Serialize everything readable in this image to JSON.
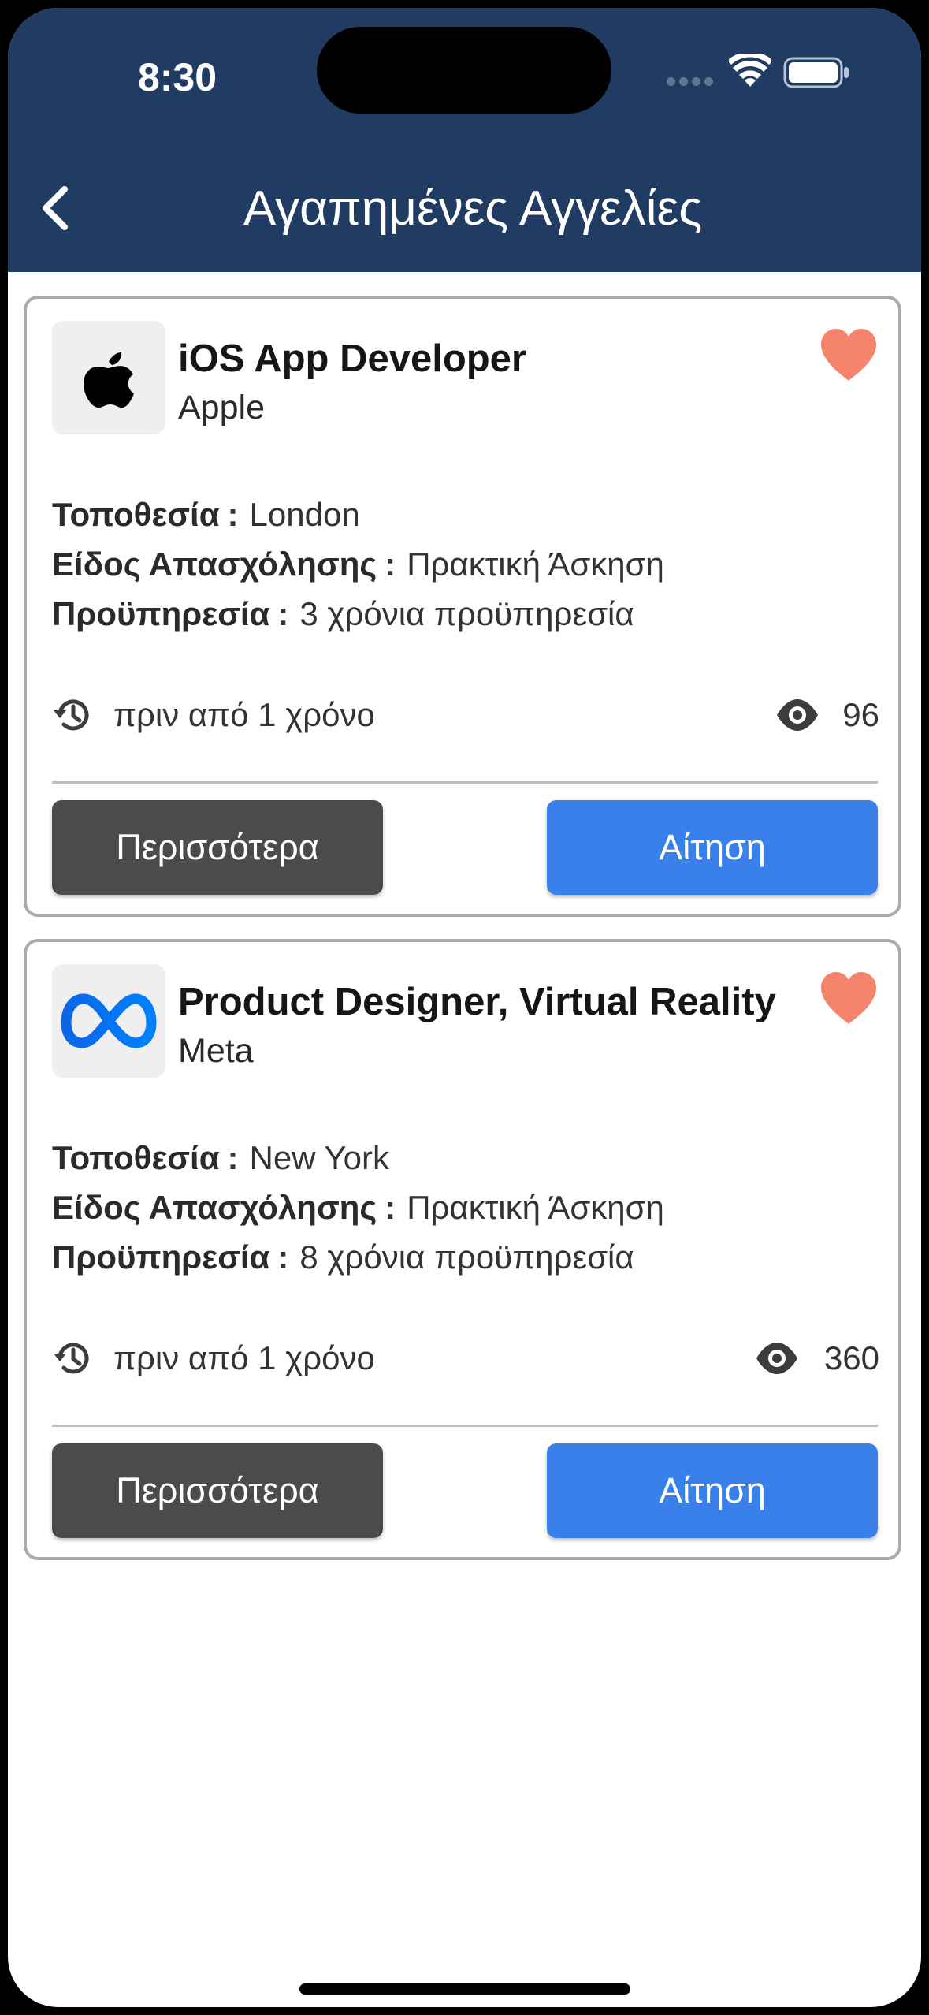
{
  "status_bar": {
    "time": "8:30"
  },
  "header": {
    "title": "Αγαπημένες Αγγελίες"
  },
  "colors": {
    "header_bg": "#213c62",
    "favorite": "#f6836b",
    "apply_button": "#3a80ea",
    "more_button": "#4b4b4b"
  },
  "labels": {
    "location": "Τοποθεσία",
    "employment_type": "Είδος Απασχόλησης",
    "experience": "Προϋπηρεσία",
    "separator": ":",
    "more_button": "Περισσότερα",
    "apply_button": "Αίτηση"
  },
  "jobs": [
    {
      "title": "iOS App Developer",
      "company": "Apple",
      "logo_icon": "apple-logo-icon",
      "location": "London",
      "employment_type": "Πρακτική Άσκηση",
      "experience": "3 χρόνια προϋπηρεσία",
      "posted": "πριν από 1 χρόνο",
      "views": "96",
      "favorite": true
    },
    {
      "title": "Product Designer, Virtual Reality",
      "company": "Meta",
      "logo_icon": "meta-logo-icon",
      "location": "New York",
      "employment_type": "Πρακτική Άσκηση",
      "experience": "8 χρόνια προϋπηρεσία",
      "posted": "πριν από 1 χρόνο",
      "views": "360",
      "favorite": true
    }
  ]
}
